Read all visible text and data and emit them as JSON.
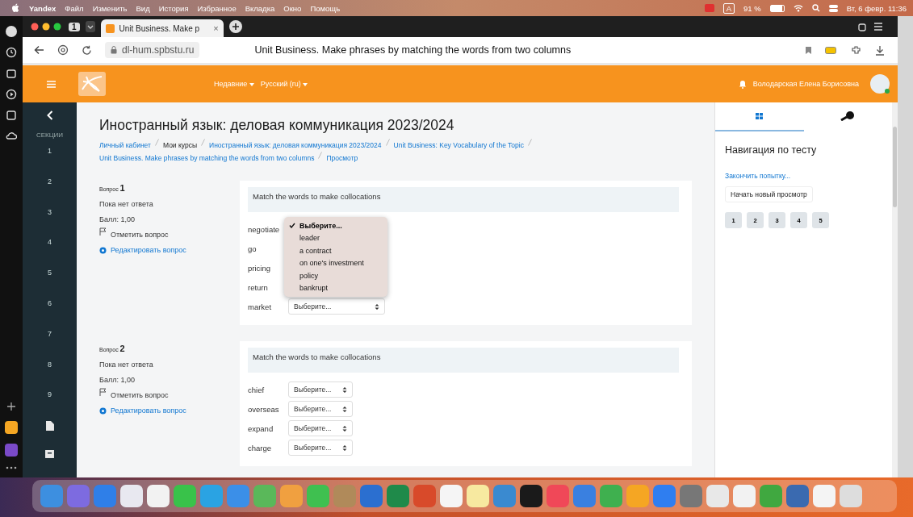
{
  "menubar": {
    "app": "Yandex",
    "items": [
      "Файл",
      "Изменить",
      "Вид",
      "История",
      "Избранное",
      "Вкладка",
      "Окно",
      "Помощь"
    ],
    "input_source": "A",
    "battery": "91 %",
    "clock": "Вт, 6 февр. 11:36"
  },
  "browser": {
    "tab_count": "1",
    "tab": {
      "title": "Unit Business. Make p",
      "close": "×"
    },
    "url": "dl-hum.spbstu.ru",
    "page_title": "Unit Business. Make phrases by matching the words from two columns"
  },
  "header": {
    "menus": [
      "Недавние",
      "Русский (ru)"
    ],
    "user": "Володарская Елена Борисовна"
  },
  "sections_nav": {
    "label": "СЕКЦИИ",
    "items": [
      "1",
      "2",
      "3",
      "4",
      "5",
      "6",
      "7",
      "8",
      "9"
    ]
  },
  "course_title": "Иностранный язык: деловая коммуникация 2023/2024",
  "breadcrumbs": [
    {
      "text": "Личный кабинет",
      "link": true
    },
    {
      "text": "Мои курсы",
      "link": false
    },
    {
      "text": "Иностранный язык: деловая коммуникация 2023/2024",
      "link": true
    },
    {
      "text": "Unit Business: Key Vocabulary of the Topic",
      "link": true
    },
    {
      "text": "Unit Business. Make phrases by matching the words from two columns",
      "link": true
    },
    {
      "text": "Просмотр",
      "link": true
    }
  ],
  "questions": [
    {
      "label": "Вопрос",
      "number": "1",
      "status": "Пока нет ответа",
      "grade": "Балл: 1,00",
      "flag": "Отметить вопрос",
      "edit": "Редактировать вопрос",
      "prompt": "Match the words to make collocations",
      "rows": [
        {
          "word": "negotiate",
          "open": true
        },
        {
          "word": "go"
        },
        {
          "word": "pricing"
        },
        {
          "word": "return"
        },
        {
          "word": "market",
          "value": "Выберите..."
        }
      ]
    },
    {
      "label": "Вопрос",
      "number": "2",
      "status": "Пока нет ответа",
      "grade": "Балл: 1,00",
      "flag": "Отметить вопрос",
      "edit": "Редактировать вопрос",
      "prompt": "Match the words to make collocations",
      "rows": [
        {
          "word": "chief",
          "value": "Выберите..."
        },
        {
          "word": "overseas",
          "value": "Выберите..."
        },
        {
          "word": "expand",
          "value": "Выберите..."
        },
        {
          "word": "charge",
          "value": "Выберите..."
        }
      ]
    }
  ],
  "dropdown": {
    "options": [
      {
        "text": "Выберите...",
        "selected": true
      },
      {
        "text": "leader",
        "selected": false
      },
      {
        "text": "a contract",
        "selected": false
      },
      {
        "text": "on one's investment",
        "selected": false
      },
      {
        "text": "policy",
        "selected": false
      },
      {
        "text": "bankrupt",
        "selected": false
      }
    ]
  },
  "quiz_nav": {
    "tabs": [
      {
        "kind": "grid",
        "selected": true
      },
      {
        "kind": "key",
        "selected": false
      }
    ],
    "title": "Навигация по тесту",
    "finish": "Закончить попытку...",
    "restart": "Начать новый просмотр",
    "buttons": [
      "1",
      "2",
      "3",
      "4",
      "5"
    ]
  }
}
